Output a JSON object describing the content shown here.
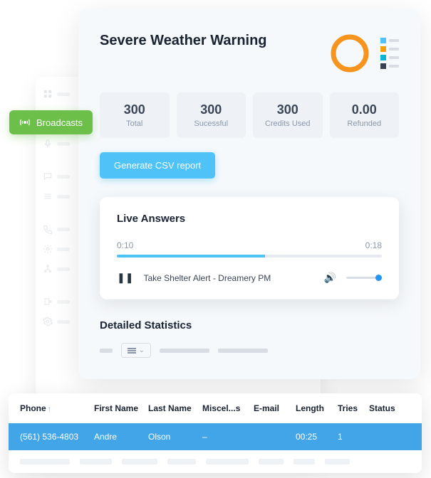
{
  "sidebar": {
    "active_label": "Broadcasts"
  },
  "main": {
    "title": "Severe Weather Warning",
    "legend_colors": [
      "#4fc3f7",
      "#f59e0b",
      "#06b6d4",
      "#374151"
    ],
    "stats": [
      {
        "value": "300",
        "label": "Total"
      },
      {
        "value": "300",
        "label": "Sucessful"
      },
      {
        "value": "300",
        "label": "Credits Used"
      },
      {
        "value": "0.00",
        "label": "Refunded"
      }
    ],
    "csv_button": "Generate CSV report"
  },
  "live": {
    "title": "Live Answers",
    "start_time": "0:10",
    "end_time": "0:18",
    "track_name": "Take Shelter Alert - Dreamery PM"
  },
  "detailed": {
    "title": "Detailed Statistics"
  },
  "table": {
    "columns": [
      "Phone",
      "First Name",
      "Last Name",
      "Miscel...s",
      "E-mail",
      "Length",
      "Tries",
      "Status"
    ],
    "row": {
      "phone": "(561) 536-4803",
      "first_name": "Andre",
      "last_name": "Olson",
      "misc": "–",
      "email": "",
      "length": "00:25",
      "tries": "1",
      "status": ""
    }
  },
  "chart_data": {
    "type": "pie",
    "title": "",
    "values": [
      300
    ],
    "categories": [
      "Total"
    ],
    "colors": [
      "#f7941e"
    ]
  }
}
